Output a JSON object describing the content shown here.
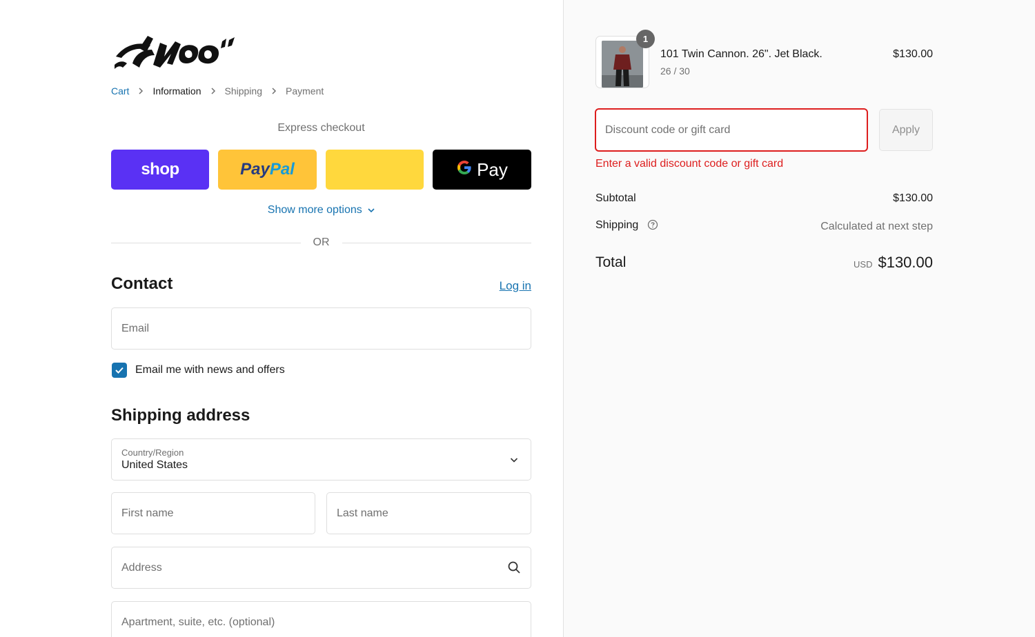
{
  "breadcrumb": {
    "cart": "Cart",
    "information": "Information",
    "shipping": "Shipping",
    "payment": "Payment"
  },
  "express": {
    "title": "Express checkout",
    "shop_label": "shop",
    "paypal_part1": "Pay",
    "paypal_part2": "Pal",
    "gpay_g": "G",
    "gpay_label": "Pay",
    "show_more": "Show more options",
    "or": "OR"
  },
  "contact": {
    "title": "Contact",
    "login": "Log in",
    "email_placeholder": "Email",
    "newsletter_label": "Email me with news and offers",
    "newsletter_checked": true
  },
  "shipping_address": {
    "title": "Shipping address",
    "country_label": "Country/Region",
    "country_value": "United States",
    "first_name_placeholder": "First name",
    "last_name_placeholder": "Last name",
    "address_placeholder": "Address",
    "apartment_placeholder": "Apartment, suite, etc. (optional)"
  },
  "order": {
    "item": {
      "quantity": "1",
      "name": "101 Twin Cannon. 26\". Jet Black.",
      "variant": "26 / 30",
      "price": "$130.00"
    },
    "discount_placeholder": "Discount code or gift card",
    "apply_label": "Apply",
    "discount_error": "Enter a valid discount code or gift card",
    "subtotal_label": "Subtotal",
    "subtotal_value": "$130.00",
    "shipping_label": "Shipping",
    "shipping_value": "Calculated at next step",
    "total_label": "Total",
    "currency": "USD",
    "total_value": "$130.00"
  },
  "colors": {
    "link": "#1773b0",
    "error": "#dd1d1d",
    "shop_pay": "#5a31f4",
    "paypal": "#ffc439"
  }
}
